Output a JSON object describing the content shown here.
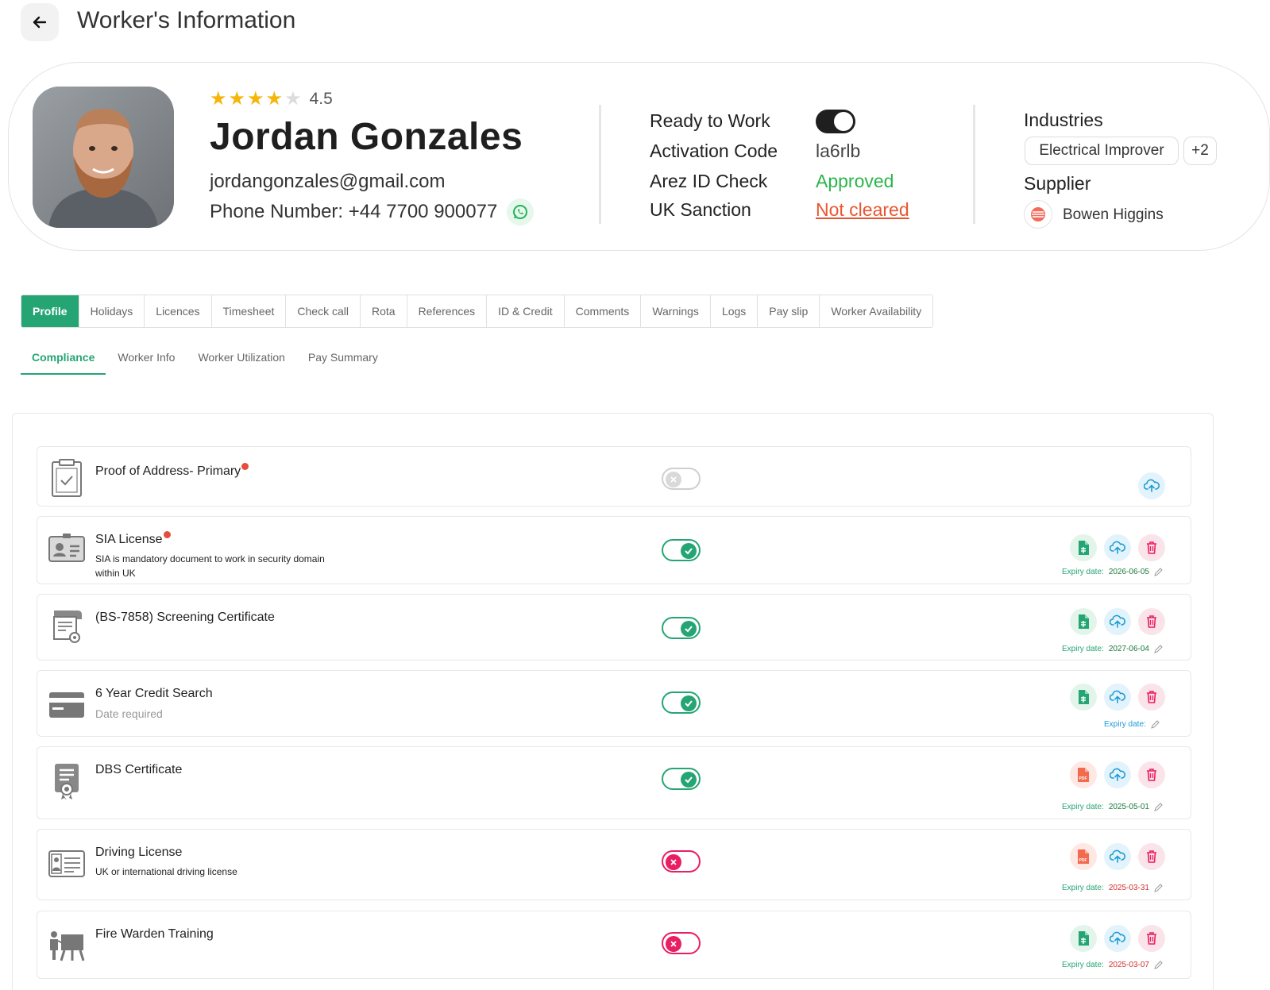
{
  "header": {
    "title": "Worker's Information"
  },
  "profile": {
    "rating": "4.5",
    "rating_value": 4.5,
    "name": "Jordan Gonzales",
    "email": "jordangonzales@gmail.com",
    "phone": "Phone Number: +44 7700 900077"
  },
  "status": {
    "ready_label": "Ready to Work",
    "ready_on": true,
    "activation_label": "Activation Code",
    "activation_value": "la6rlb",
    "id_check_label": "Arez ID Check",
    "id_check_value": "Approved",
    "sanction_label": "UK Sanction",
    "sanction_value": "Not cleared"
  },
  "industries": {
    "title": "Industries",
    "primary": "Electrical Improver",
    "more": "+2"
  },
  "supplier": {
    "title": "Supplier",
    "name": "Bowen Higgins"
  },
  "tabs": [
    "Profile",
    "Holidays",
    "Licences",
    "Timesheet",
    "Check call",
    "Rota",
    "References",
    "ID & Credit",
    "Comments",
    "Warnings",
    "Logs",
    "Pay slip",
    "Worker Availability"
  ],
  "subtabs": [
    "Compliance",
    "Worker Info",
    "Worker Utilization",
    "Pay Summary"
  ],
  "compliance": {
    "expiry_label": "Expiry date:",
    "items": [
      {
        "title": "Proof of Address- Primary",
        "required": true,
        "desc": "",
        "toggle": "none",
        "expiry": ""
      },
      {
        "title": "SIA License",
        "required": true,
        "desc": "SIA is mandatory document to work in security domain within UK",
        "toggle": "on",
        "expiry": "2026-06-05"
      },
      {
        "title": "(BS-7858) Screening Certificate",
        "required": false,
        "desc": "",
        "toggle": "on",
        "expiry": "2027-06-04"
      },
      {
        "title": "6 Year Credit Search",
        "required": false,
        "desc": "Date required",
        "toggle": "on",
        "expiry": ""
      },
      {
        "title": "DBS Certificate",
        "required": false,
        "desc": "",
        "toggle": "on",
        "expiry": "2025-05-01"
      },
      {
        "title": "Driving License",
        "required": false,
        "desc": "UK or international driving license",
        "toggle": "off",
        "expiry": "2025-03-31"
      },
      {
        "title": "Fire Warden Training",
        "required": false,
        "desc": "",
        "toggle": "off",
        "expiry": "2025-03-07"
      }
    ]
  },
  "colors": {
    "accent": "#26a574",
    "approved": "#2bb54a",
    "not_cleared": "#e8552f",
    "danger": "#e91e63",
    "upload": "#1a9bd6"
  },
  "icons": [
    "back-arrow-icon",
    "star-icon",
    "whatsapp-icon",
    "clipboard-check-icon",
    "id-card-icon",
    "certificate-icon",
    "credit-card-icon",
    "badge-certificate-icon",
    "driving-license-icon",
    "training-icon",
    "document-icon",
    "pdf-icon",
    "upload-cloud-icon",
    "trash-icon",
    "edit-pencil-icon"
  ]
}
